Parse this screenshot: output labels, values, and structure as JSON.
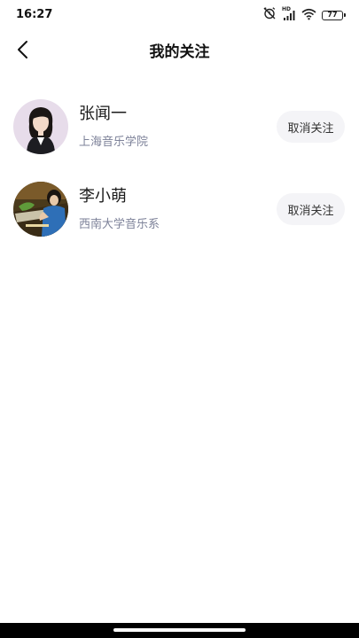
{
  "status_bar": {
    "time": "16:27",
    "battery_level": "77",
    "network_label": "HD"
  },
  "header": {
    "title": "我的关注"
  },
  "follows": [
    {
      "name": "张闻一",
      "org": "上海音乐学院",
      "action": "取消关注"
    },
    {
      "name": "李小萌",
      "org": "西南大学音乐系",
      "action": "取消关注"
    }
  ]
}
